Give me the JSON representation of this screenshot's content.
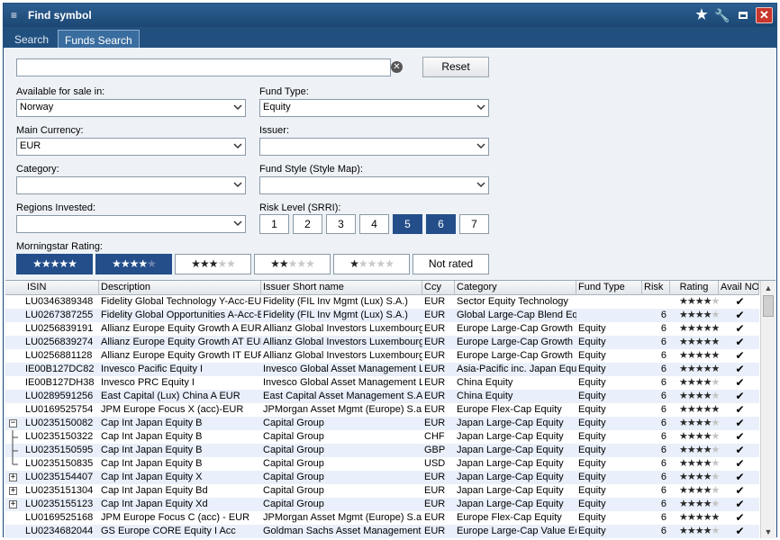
{
  "window": {
    "title": "Find symbol",
    "icons": [
      "menu-icon",
      "star-icon",
      "wrench-icon",
      "maximize-icon",
      "close-icon"
    ]
  },
  "tabs": [
    {
      "label": "Search",
      "active": false
    },
    {
      "label": "Funds Search",
      "active": true
    }
  ],
  "search": {
    "value": "",
    "placeholder": "",
    "reset_label": "Reset"
  },
  "filters": {
    "available_label": "Available for sale in:",
    "available_value": "Norway",
    "fund_type_label": "Fund Type:",
    "fund_type_value": "Equity",
    "currency_label": "Main Currency:",
    "currency_value": "EUR",
    "issuer_label": "Issuer:",
    "issuer_value": "",
    "category_label": "Category:",
    "category_value": "",
    "style_label": "Fund Style (Style Map):",
    "style_value": "",
    "regions_label": "Regions Invested:",
    "regions_value": "",
    "risk_label": "Risk Level (SRRI):",
    "risk_levels": [
      "1",
      "2",
      "3",
      "4",
      "5",
      "6",
      "7"
    ],
    "risk_selected": [
      "5",
      "6"
    ],
    "rating_label": "Morningstar Rating:",
    "rating_options": [
      5,
      4,
      3,
      2,
      1
    ],
    "rating_selected": [
      5,
      4
    ],
    "not_rated_label": "Not rated"
  },
  "grid": {
    "columns": [
      "ISIN",
      "Description",
      "Issuer Short name",
      "Ccy",
      "Category",
      "Fund Type",
      "Risk",
      "Rating",
      "Avail NO"
    ],
    "rows": [
      {
        "isin": "LU0346389348",
        "desc": "Fidelity Global Technology Y-Acc-EUR",
        "issuer": "Fidelity (FIL Inv Mgmt (Lux) S.A.)",
        "ccy": "EUR",
        "cat": "Sector Equity Technology",
        "type": "",
        "risk": "",
        "rating": 4,
        "avail": "✔",
        "tree": ""
      },
      {
        "isin": "LU0267387255",
        "desc": "Fidelity Global Opportunities A-Acc-EUR",
        "issuer": "Fidelity (FIL Inv Mgmt (Lux) S.A.)",
        "ccy": "EUR",
        "cat": "Global Large-Cap Blend Equity",
        "type": "",
        "risk": "6",
        "rating": 4,
        "avail": "✔",
        "tree": ""
      },
      {
        "isin": "LU0256839191",
        "desc": "Allianz Europe Equity Growth A EUR",
        "issuer": "Allianz Global Investors Luxembourg",
        "ccy": "EUR",
        "cat": "Europe Large-Cap Growth Equity",
        "type": "Equity",
        "risk": "6",
        "rating": 5,
        "avail": "✔",
        "tree": ""
      },
      {
        "isin": "LU0256839274",
        "desc": "Allianz Europe Equity Growth AT EUR",
        "issuer": "Allianz Global Investors Luxembourg",
        "ccy": "EUR",
        "cat": "Europe Large-Cap Growth Equity",
        "type": "Equity",
        "risk": "6",
        "rating": 5,
        "avail": "✔",
        "tree": ""
      },
      {
        "isin": "LU0256881128",
        "desc": "Allianz Europe Equity Growth IT EUR",
        "issuer": "Allianz Global Investors Luxembourg",
        "ccy": "EUR",
        "cat": "Europe Large-Cap Growth Equity",
        "type": "Equity",
        "risk": "6",
        "rating": 5,
        "avail": "✔",
        "tree": ""
      },
      {
        "isin": "IE00B127DC82",
        "desc": "Invesco Pacific Equity I",
        "issuer": "Invesco Global Asset Management Limited",
        "ccy": "EUR",
        "cat": "Asia-Pacific inc. Japan Equity",
        "type": "Equity",
        "risk": "6",
        "rating": 5,
        "avail": "✔",
        "tree": ""
      },
      {
        "isin": "IE00B127DH38",
        "desc": "Invesco PRC Equity I",
        "issuer": "Invesco Global Asset Management Limited",
        "ccy": "EUR",
        "cat": "China Equity",
        "type": "Equity",
        "risk": "6",
        "rating": 4,
        "avail": "✔",
        "tree": ""
      },
      {
        "isin": "LU0289591256",
        "desc": "East Capital (Lux) China A EUR",
        "issuer": "East Capital Asset Management S.A.",
        "ccy": "EUR",
        "cat": "China Equity",
        "type": "Equity",
        "risk": "6",
        "rating": 4,
        "avail": "✔",
        "tree": ""
      },
      {
        "isin": "LU0169525754",
        "desc": "JPM Europe Focus X (acc)-EUR",
        "issuer": "JPMorgan Asset Mgmt (Europe) S.a.r.l.",
        "ccy": "EUR",
        "cat": "Europe Flex-Cap Equity",
        "type": "Equity",
        "risk": "6",
        "rating": 5,
        "avail": "✔",
        "tree": ""
      },
      {
        "isin": "LU0235150082",
        "desc": "Cap Int Japan Equity B",
        "issuer": "Capital Group",
        "ccy": "EUR",
        "cat": "Japan Large-Cap Equity",
        "type": "Equity",
        "risk": "6",
        "rating": 4,
        "avail": "✔",
        "tree": "minus"
      },
      {
        "isin": "LU0235150322",
        "desc": "Cap Int Japan Equity B",
        "issuer": "Capital Group",
        "ccy": "CHF",
        "cat": "Japan Large-Cap Equity",
        "type": "Equity",
        "risk": "6",
        "rating": 4,
        "avail": "✔",
        "tree": "mid"
      },
      {
        "isin": "LU0235150595",
        "desc": "Cap Int Japan Equity B",
        "issuer": "Capital Group",
        "ccy": "GBP",
        "cat": "Japan Large-Cap Equity",
        "type": "Equity",
        "risk": "6",
        "rating": 4,
        "avail": "✔",
        "tree": "mid"
      },
      {
        "isin": "LU0235150835",
        "desc": "Cap Int Japan Equity B",
        "issuer": "Capital Group",
        "ccy": "USD",
        "cat": "Japan Large-Cap Equity",
        "type": "Equity",
        "risk": "6",
        "rating": 4,
        "avail": "✔",
        "tree": "end"
      },
      {
        "isin": "LU0235154407",
        "desc": "Cap Int Japan Equity X",
        "issuer": "Capital Group",
        "ccy": "EUR",
        "cat": "Japan Large-Cap Equity",
        "type": "Equity",
        "risk": "6",
        "rating": 4,
        "avail": "✔",
        "tree": "plus"
      },
      {
        "isin": "LU0235151304",
        "desc": "Cap Int Japan Equity Bd",
        "issuer": "Capital Group",
        "ccy": "EUR",
        "cat": "Japan Large-Cap Equity",
        "type": "Equity",
        "risk": "6",
        "rating": 4,
        "avail": "✔",
        "tree": "plus"
      },
      {
        "isin": "LU0235155123",
        "desc": "Cap Int Japan Equity Xd",
        "issuer": "Capital Group",
        "ccy": "EUR",
        "cat": "Japan Large-Cap Equity",
        "type": "Equity",
        "risk": "6",
        "rating": 4,
        "avail": "✔",
        "tree": "plus"
      },
      {
        "isin": "LU0169525168",
        "desc": "JPM Europe Focus C (acc) - EUR",
        "issuer": "JPMorgan Asset Mgmt (Europe) S.a.r.l.",
        "ccy": "EUR",
        "cat": "Europe Flex-Cap Equity",
        "type": "Equity",
        "risk": "6",
        "rating": 5,
        "avail": "✔",
        "tree": ""
      },
      {
        "isin": "LU0234682044",
        "desc": "GS Europe CORE Equity I Acc",
        "issuer": "Goldman Sachs Asset Management International",
        "ccy": "EUR",
        "cat": "Europe Large-Cap Value Equity",
        "type": "Equity",
        "risk": "6",
        "rating": 4,
        "avail": "✔",
        "tree": ""
      }
    ]
  }
}
